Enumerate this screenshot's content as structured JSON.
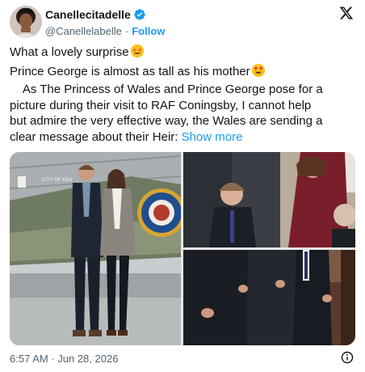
{
  "header": {
    "display_name": "Canellecitadelle",
    "handle": "@Canellelabelle",
    "separator": "·",
    "follow_label": "Follow",
    "verified_icon": "verified-badge-icon",
    "platform_icon": "x-logo-icon"
  },
  "tweet": {
    "line1": "What a lovely surprise",
    "line1_emoji": "star-struck-emoji",
    "line2": "Prince George is almost as tall as his mother",
    "line2_emoji": "heart-eyes-emoji",
    "line3": "    As The Princess of Wales and Prince George pose for a",
    "line4": "picture during their visit to RAF Coningsby, I cannot help",
    "line5": "but admire the very effective way, the Wales are sending a",
    "line6": "clear message about their Heir: ",
    "show_more": "Show more"
  },
  "media": {
    "photo1": {
      "aircraft_text": "CITY OF KEN"
    }
  },
  "footer": {
    "timestamp": "6:57 AM · Jun 28, 2026",
    "info_icon": "info-icon"
  },
  "colors": {
    "link": "#1d9bf0",
    "text": "#0f1419",
    "muted": "#536471"
  }
}
